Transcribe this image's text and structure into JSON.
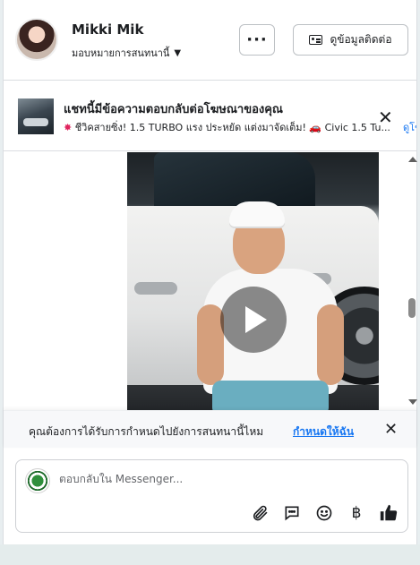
{
  "header": {
    "name": "Mikki Mik",
    "assign_label": "มอบหมายการสนทนานี้",
    "more_label": "···",
    "contact_label": "ดูข้อมูลติดต่อ"
  },
  "ad_banner": {
    "title": "แชทนี้มีข้อความตอบกลับต่อโฆษณาของคุณ",
    "subtitle": "ชีวิคสายซิ่ง! 1.5 TURBO แรง ประหยัด แต่งมาจัดเต็ม! 🚗 Civic 1.5 Tu...",
    "more_link": "ดูโฆ"
  },
  "assign_prompt": {
    "text": "คุณต้องการได้รับการกำหนดไปยังการสนทนานี้ไหม",
    "link": "กำหนดให้ฉัน"
  },
  "composer": {
    "placeholder": "ตอบกลับใน Messenger...",
    "baht_label": "฿"
  },
  "colors": {
    "accent": "#1877f2",
    "border": "#dadde1"
  }
}
